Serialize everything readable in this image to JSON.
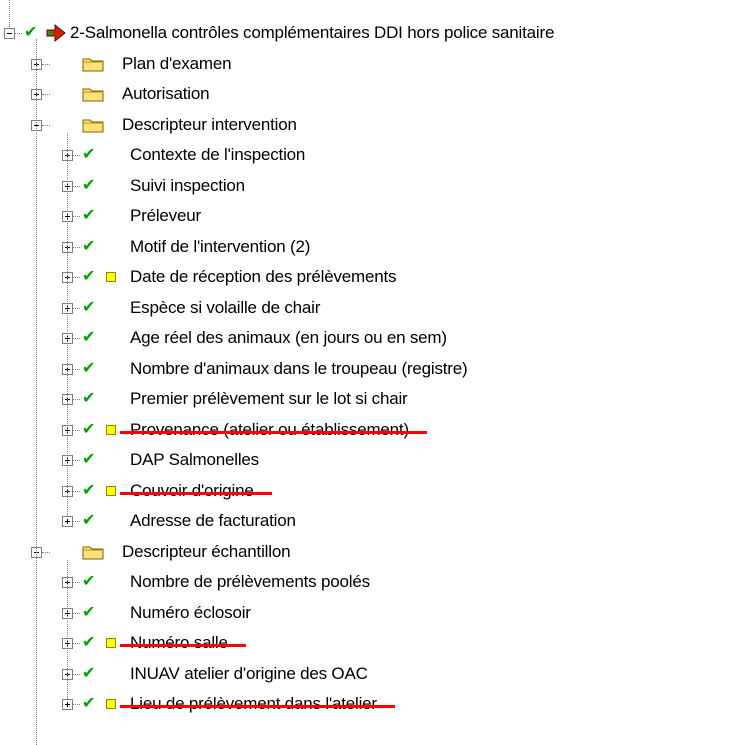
{
  "root": {
    "label": "2-Salmonella contrôles complémentaires DDI hors police sanitaire",
    "expanded": true,
    "checked": true
  },
  "groups": [
    {
      "label": "Plan d'examen",
      "expanded": false,
      "children": []
    },
    {
      "label": "Autorisation",
      "expanded": false,
      "children": []
    },
    {
      "label": "Descripteur intervention",
      "expanded": true,
      "children": [
        {
          "label": "Contexte de l'inspection",
          "note": false,
          "struck": false
        },
        {
          "label": "Suivi inspection",
          "note": false,
          "struck": false
        },
        {
          "label": "Préleveur",
          "note": false,
          "struck": false
        },
        {
          "label": "Motif de l'intervention (2)",
          "note": false,
          "struck": false
        },
        {
          "label": "Date de réception des prélèvements",
          "note": true,
          "struck": false
        },
        {
          "label": "Espèce si volaille de chair",
          "note": false,
          "struck": false
        },
        {
          "label": "Age réel des animaux (en jours ou en sem)",
          "note": false,
          "struck": false
        },
        {
          "label": "Nombre d'animaux dans le troupeau (registre)",
          "note": false,
          "struck": false
        },
        {
          "label": "Premier prélèvement sur le lot si chair",
          "note": false,
          "struck": false
        },
        {
          "label": "Provenance (atelier ou établissement)",
          "note": true,
          "struck": true
        },
        {
          "label": "DAP Salmonelles",
          "note": false,
          "struck": false
        },
        {
          "label": "Couvoir d'origine",
          "note": true,
          "struck": true
        },
        {
          "label": "Adresse de facturation",
          "note": false,
          "struck": false
        }
      ]
    },
    {
      "label": "Descripteur échantillon",
      "expanded": true,
      "children": [
        {
          "label": "Nombre de prélèvements poolés",
          "note": false,
          "struck": false
        },
        {
          "label": "Numéro  éclosoir",
          "note": false,
          "struck": false
        },
        {
          "label": "Numéro salle",
          "note": true,
          "struck": true
        },
        {
          "label": "INUAV atelier d'origine des OAC",
          "note": false,
          "struck": false
        },
        {
          "label": "Lieu de prélèvement dans l'atelier",
          "note": true,
          "struck": true
        }
      ]
    }
  ],
  "colors": {
    "check": "#00a000",
    "folder": "#ffe27a",
    "note": "#ffff00",
    "strike": "#ff0000",
    "arrow": "#cc2200"
  }
}
